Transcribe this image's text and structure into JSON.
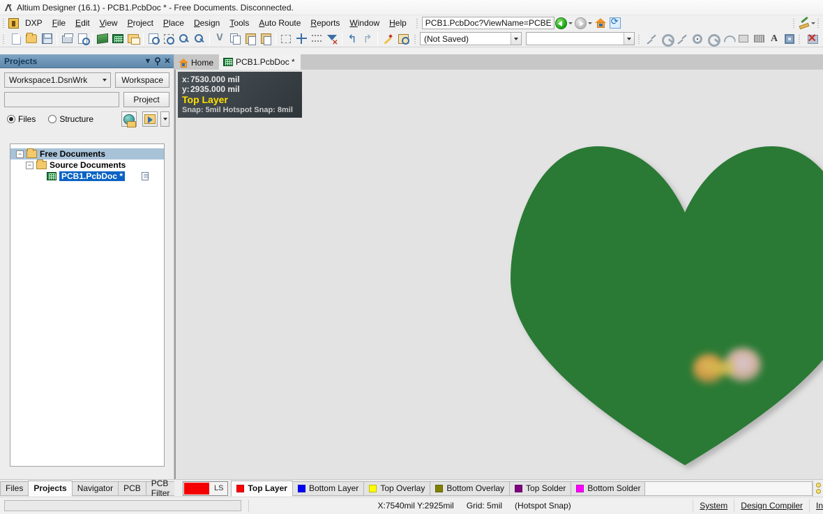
{
  "window": {
    "title": "Altium Designer (16.1) - PCB1.PcbDoc * - Free Documents. Disconnected.",
    "app_icon": "altium-a-icon"
  },
  "menubar": {
    "dxp_label": "DXP",
    "items": [
      "File",
      "Edit",
      "View",
      "Project",
      "Place",
      "Design",
      "Tools",
      "Auto Route",
      "Reports",
      "Window",
      "Help"
    ],
    "address_value": "PCB1.PcbDoc?ViewName=PCBE",
    "nav_back_icon": "back-arrow-icon",
    "nav_forward_icon": "forward-arrow-icon",
    "home_icon": "home-icon",
    "refresh_icon": "refresh-icon",
    "ruler_icon": "ruler-pencil-icon"
  },
  "toolbar": {
    "group1": [
      "new-document-icon",
      "open-document-icon",
      "save-document-icon"
    ],
    "group2": [
      "print-icon",
      "print-preview-icon"
    ],
    "group3": [
      "pcb-3d-icon",
      "pcb-document-icon",
      "window-tile-icon"
    ],
    "group4": [
      "zoom-document-icon",
      "zoom-area-icon",
      "zoom-in-icon",
      "zoom-filter-icon"
    ],
    "group5": [
      "cut-icon",
      "copy-icon",
      "paste-icon",
      "paste-special-icon"
    ],
    "group6": [
      "rubber-band-select-icon",
      "move-icon",
      "align-icon",
      "clear-filter-icon"
    ],
    "group7": [
      "undo-icon",
      "redo-icon"
    ],
    "group8": [
      "highlight-pencil-icon",
      "inspector-icon"
    ],
    "saved_state": "(Not Saved)",
    "second_combo_value": "",
    "place_tools": [
      "place-track-icon",
      "place-interactive-route-icon",
      "place-track2-icon",
      "place-via-icon",
      "place-pad-icon",
      "place-arc-icon",
      "place-fill-icon",
      "place-polygon-icon",
      "place-string-icon",
      "place-component-icon"
    ],
    "clear_icon": "clear-all-icon"
  },
  "projects_panel": {
    "title": "Projects",
    "header_buttons": [
      "dropdown-icon",
      "pin-icon",
      "close-icon"
    ],
    "workspace_value": "Workspace1.DsnWrk",
    "workspace_button": "Workspace",
    "project_value": "",
    "project_button": "Project",
    "view_modes": [
      {
        "label": "Files",
        "selected": true
      },
      {
        "label": "Structure",
        "selected": false
      }
    ],
    "tool_buttons": [
      "globe-folder-icon",
      "open-project-icon",
      "dropdown-arrow-icon"
    ],
    "tree": [
      {
        "label": "Free Documents",
        "level": 0,
        "expanded": true,
        "icon": "folder-icon",
        "selected": true
      },
      {
        "label": "Source Documents",
        "level": 1,
        "expanded": true,
        "icon": "folder-icon",
        "selected": false
      },
      {
        "label": "PCB1.PcbDoc *",
        "level": 2,
        "expanded": false,
        "icon": "pcb-document-icon",
        "selected": true,
        "status_icon": "page-icon"
      }
    ]
  },
  "document_tabs": [
    {
      "label": "Home",
      "icon": "home-icon",
      "active": false
    },
    {
      "label": "PCB1.PcbDoc *",
      "icon": "pcb-document-icon",
      "active": true
    }
  ],
  "hud": {
    "x_key": "x:",
    "x_value": "7530.000 mil",
    "y_key": "y:",
    "y_value": "2935.000 mil",
    "layer": "Top Layer",
    "snap": "Snap: 5mil Hotspot Snap: 8mil"
  },
  "canvas": {
    "background_color": "#e3e3e3",
    "shapes": [
      {
        "name": "heart-polygon",
        "type": "heart",
        "fill": "#2a7a36"
      },
      {
        "name": "blurred-blob",
        "type": "blob",
        "fill_a": "#e0a04a",
        "fill_b": "#e3bcc9"
      }
    ]
  },
  "panel_tabs": [
    {
      "label": "Files",
      "selected": false
    },
    {
      "label": "Projects",
      "selected": true
    },
    {
      "label": "Navigator",
      "selected": false
    },
    {
      "label": "PCB",
      "selected": false
    },
    {
      "label": "PCB Filter",
      "selected": false
    }
  ],
  "layer_tabs": {
    "ls_swatch_color": "#f50000",
    "ls_label": "LS",
    "items": [
      {
        "label": "Top Layer",
        "color": "#ff0000",
        "selected": true
      },
      {
        "label": "Bottom Layer",
        "color": "#0000ff",
        "selected": false
      },
      {
        "label": "Top Overlay",
        "color": "#ffff00",
        "selected": false
      },
      {
        "label": "Bottom Overlay",
        "color": "#808000",
        "selected": false
      },
      {
        "label": "Top Solder",
        "color": "#800080",
        "selected": false
      },
      {
        "label": "Bottom Solder",
        "color": "#ff00ff",
        "selected": false
      }
    ]
  },
  "statusbar": {
    "command_value": "",
    "coordinates": "X:7540mil Y:2925mil",
    "grid": "Grid: 5mil",
    "snap_mode": "(Hotspot Snap)",
    "buttons": [
      "System",
      "Design Compiler",
      "In"
    ]
  }
}
